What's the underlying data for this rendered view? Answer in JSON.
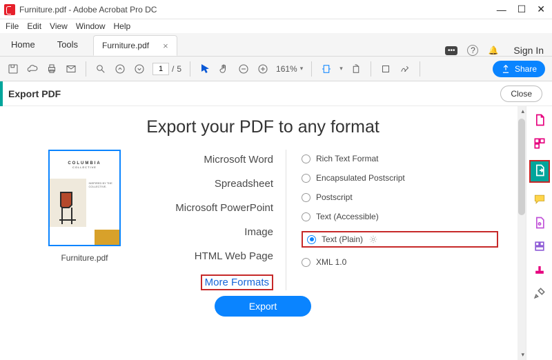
{
  "window": {
    "title": "Furniture.pdf - Adobe Acrobat Pro DC"
  },
  "menu": {
    "file": "File",
    "edit": "Edit",
    "view": "View",
    "window": "Window",
    "help": "Help"
  },
  "tabs": {
    "home": "Home",
    "tools": "Tools",
    "doc": "Furniture.pdf",
    "signin": "Sign In"
  },
  "toolbar": {
    "page_current": "1",
    "page_sep": "/",
    "page_total": "5",
    "zoom": "161%",
    "share": "Share"
  },
  "panel": {
    "title": "Export PDF",
    "close": "Close"
  },
  "export": {
    "heading": "Export your PDF to any format",
    "thumb_label": "COLUMBIA",
    "thumb_sub": "COLLECTIVE",
    "thumb_body": "INSPIRED BY THE COLLECTIVE.",
    "thumb_name": "Furniture.pdf",
    "formats": {
      "word": "Microsoft Word",
      "spreadsheet": "Spreadsheet",
      "ppt": "Microsoft PowerPoint",
      "image": "Image",
      "html": "HTML Web Page",
      "more": "More Formats"
    },
    "options": {
      "rtf": "Rich Text Format",
      "eps": "Encapsulated Postscript",
      "ps": "Postscript",
      "txt_acc": "Text (Accessible)",
      "txt_plain": "Text (Plain)",
      "xml": "XML 1.0"
    },
    "button": "Export"
  }
}
